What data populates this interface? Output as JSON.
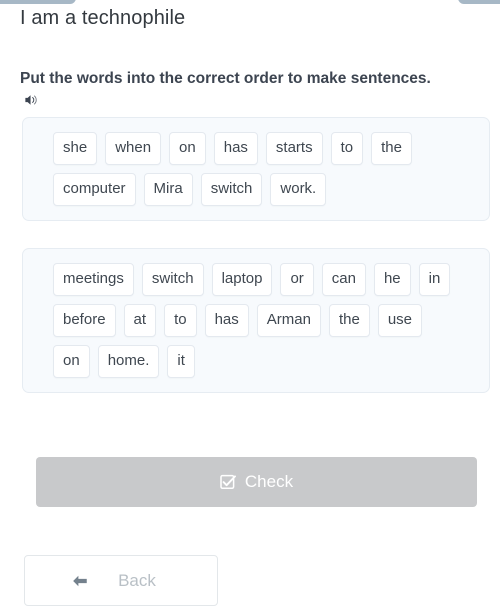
{
  "top_stubs": [
    {
      "name": "clipped-bar-left",
      "color": "#a7b8c6"
    },
    {
      "name": "clipped-bar-right",
      "color": "#a7b8c6"
    }
  ],
  "header": {
    "title": "I am a technophile"
  },
  "instruction": {
    "text": "Put the words into the correct order to make sentences.",
    "audio_icon": "speaker-icon"
  },
  "word_banks": [
    {
      "id": "sentence-1",
      "rows": [
        [
          "she",
          "when",
          "on",
          "has",
          "starts",
          "to",
          "the"
        ],
        [
          "computer",
          "Mira",
          "switch",
          "work."
        ]
      ]
    },
    {
      "id": "sentence-2",
      "rows": [
        [
          "meetings",
          "switch",
          "laptop",
          "or",
          "can",
          "he",
          "in"
        ],
        [
          "before",
          "at",
          "to",
          "has",
          "Arman",
          "the",
          "use"
        ],
        [
          "on",
          "home.",
          "it"
        ]
      ]
    }
  ],
  "check_button": {
    "label": "Check",
    "icon": "checkbox-checked-icon",
    "disabled": true,
    "background": "#c8c9cb",
    "text_color": "#ffffff"
  },
  "back_button": {
    "label": "Back",
    "icon": "arrow-left-icon",
    "text_color": "#b9c0c6",
    "border_color": "#e3e7ea"
  },
  "theme": {
    "panel_background": "#f7fafd",
    "panel_border": "#e6ecf2",
    "chip_background": "#ffffff",
    "chip_border": "#e4e9ef",
    "chip_text": "#3f4750",
    "title_color": "#33393f",
    "instruction_color": "#3c4450"
  }
}
